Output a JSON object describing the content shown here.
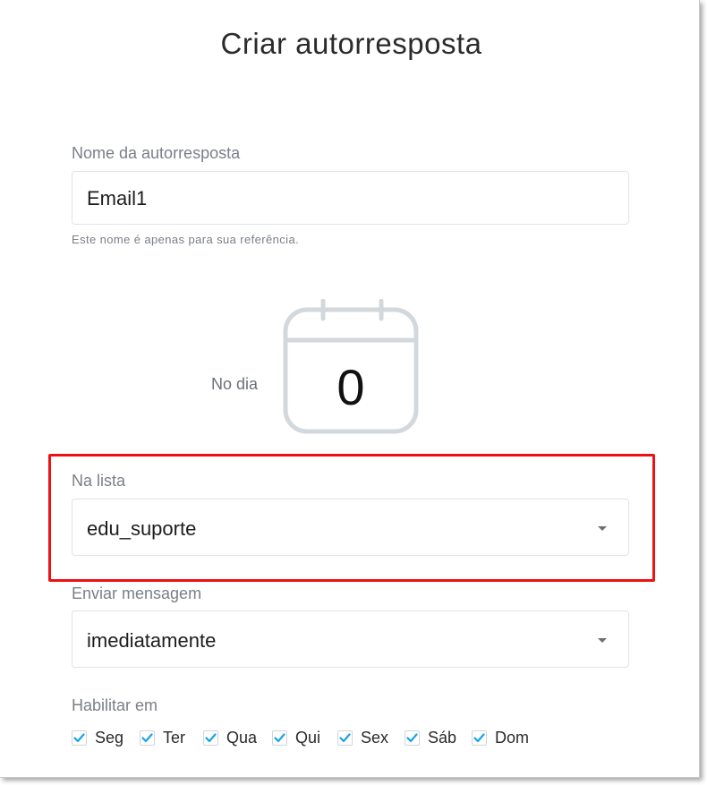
{
  "page": {
    "title": "Criar autorresposta"
  },
  "name_field": {
    "label": "Nome da autorresposta",
    "value": "Email1",
    "helper": "Este nome é apenas para sua referência."
  },
  "day": {
    "label": "No dia",
    "value": "0",
    "icon": "calendar-icon"
  },
  "list_field": {
    "label": "Na lista",
    "value": "edu_suporte",
    "icon": "chevron-down-icon"
  },
  "send_field": {
    "label": "Enviar mensagem",
    "value": "imediatamente",
    "icon": "chevron-down-icon"
  },
  "enable": {
    "label": "Habilitar em",
    "days": [
      {
        "label": "Seg",
        "checked": true
      },
      {
        "label": "Ter",
        "checked": true
      },
      {
        "label": "Qua",
        "checked": true
      },
      {
        "label": "Qui",
        "checked": true
      },
      {
        "label": "Sex",
        "checked": true
      },
      {
        "label": "Sáb",
        "checked": true
      },
      {
        "label": "Dom",
        "checked": true
      }
    ]
  },
  "colors": {
    "highlight": "#ee1111",
    "check": "#1aa3e6",
    "calendar": "#d3d8dd"
  }
}
